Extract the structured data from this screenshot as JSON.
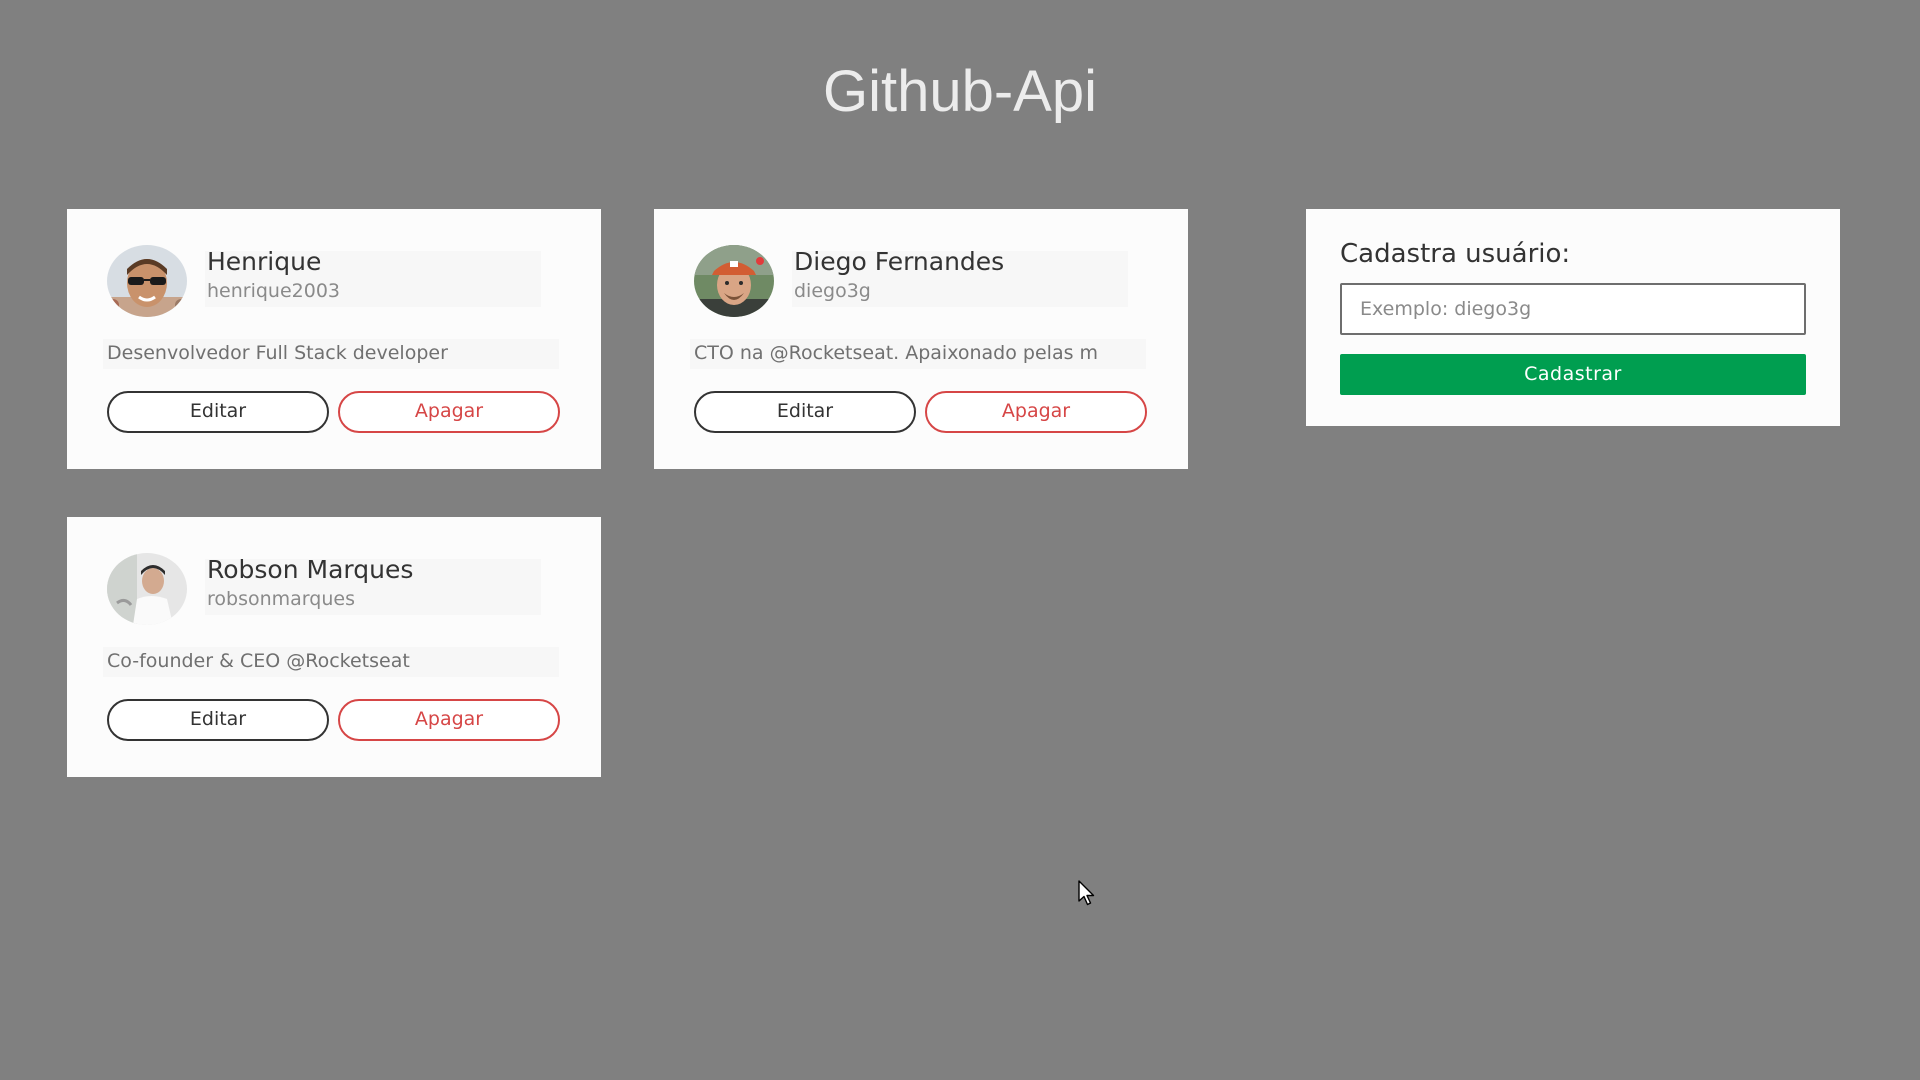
{
  "app": {
    "title": "Github-Api"
  },
  "users": [
    {
      "name": "Henrique",
      "login": "henrique2003",
      "bio": "Desenvolvedor Full Stack developer",
      "edit_label": "Editar",
      "delete_label": "Apagar"
    },
    {
      "name": "Diego Fernandes",
      "login": "diego3g",
      "bio": "CTO na @Rocketseat. Apaixonado pelas m",
      "edit_label": "Editar",
      "delete_label": "Apagar"
    },
    {
      "name": "Robson Marques",
      "login": "robsonmarques",
      "bio": "Co-founder & CEO @Rocketseat",
      "edit_label": "Editar",
      "delete_label": "Apagar"
    }
  ],
  "form": {
    "title": "Cadastra usuário:",
    "input_value": "",
    "input_placeholder": "Exemplo: diego3g",
    "submit_label": "Cadastrar"
  },
  "colors": {
    "background": "#808080",
    "card": "#fcfcfc",
    "edit_border": "#333333",
    "delete_accent": "#d64646",
    "submit": "#009e50"
  },
  "icons": [
    "avatar-henrique",
    "avatar-diego",
    "avatar-robson",
    "mouse-pointer-icon"
  ]
}
